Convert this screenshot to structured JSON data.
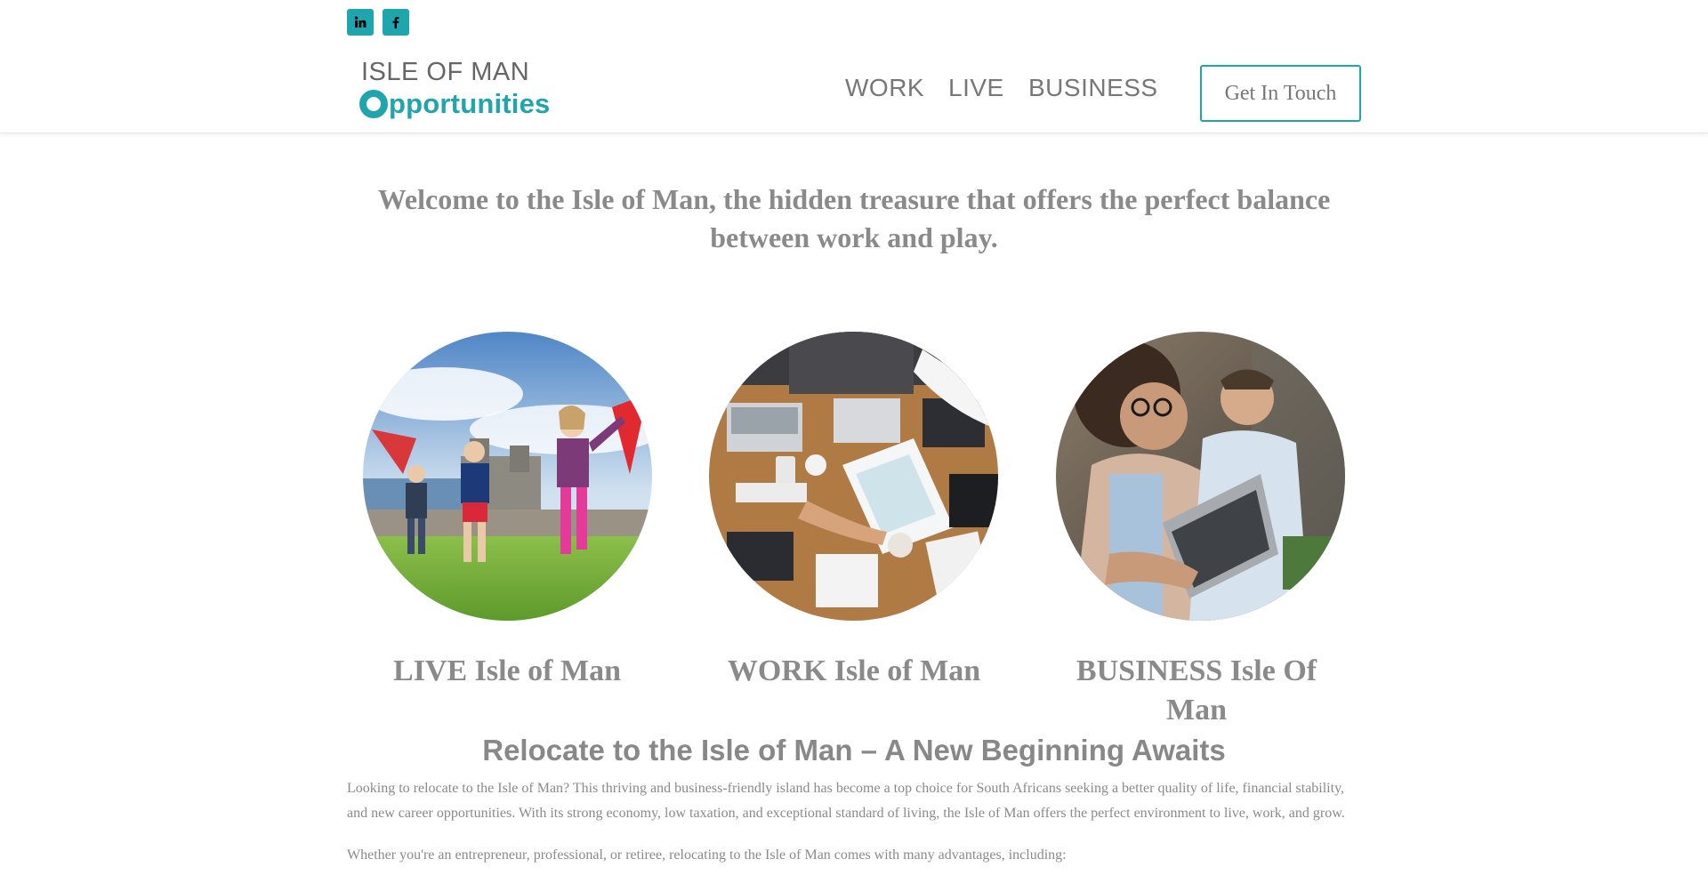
{
  "social": {
    "linkedin_label": "in",
    "facebook_label": "f"
  },
  "logo": {
    "line1": "ISLE OF MAN",
    "line2_rest": "pportunities"
  },
  "nav": {
    "items": [
      "WORK",
      "LIVE",
      "BUSINESS"
    ],
    "cta": "Get In Touch"
  },
  "welcome": {
    "text": "Welcome to the Isle of Man, the hidden treasure that offers the perfect balance between work and play."
  },
  "cards": [
    {
      "title": "LIVE Isle of Man",
      "image": "children-running-castle-photo"
    },
    {
      "title": "WORK Isle of Man",
      "image": "office-desk-laptops-photo"
    },
    {
      "title": "BUSINESS Isle Of Man",
      "image": "people-laptop-office-photo"
    }
  ],
  "relocate": {
    "heading": "Relocate to the Isle of Man – A New Beginning Awaits",
    "paragraph1": "Looking to relocate to the Isle of Man? This thriving and business-friendly island has become a top choice for South Africans seeking a better quality of life, financial stability, and new career opportunities. With its strong economy, low taxation, and exceptional standard of living, the Isle of Man offers the perfect environment to live, work, and grow.",
    "paragraph2": "Whether you're an entrepreneur, professional, or retiree, relocating to the Isle of Man comes with many advantages, including:"
  },
  "colors": {
    "accent": "#1fa5ad",
    "text": "#888888"
  }
}
